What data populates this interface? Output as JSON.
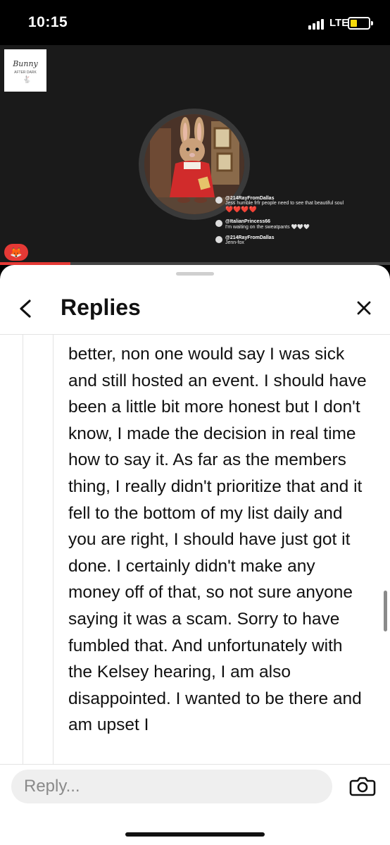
{
  "status_bar": {
    "time": "10:15",
    "network": "LTE"
  },
  "stream": {
    "logo_text": "Bunny",
    "logo_subtext": "AFTER DARK",
    "chat": [
      {
        "user": "@214RayFromDallas",
        "text": "Jess humble frfr people need to see that beautiful soul",
        "hearts": "❤️❤️❤️❤️"
      },
      {
        "user": "@ItalianPrincess66",
        "text": "I'm waiting on the sweatpants 🤍🤍🤍",
        "hearts": ""
      },
      {
        "user": "@214RayFromDallas",
        "text": "Jenn-fox",
        "hearts": ""
      }
    ],
    "progress": 0.18
  },
  "sheet": {
    "title": "Replies",
    "body": "better, non one would say I was sick and still hosted an event. I should have been a little bit more honest but I don't know, I made the decision in real time how to say it.   As far as the members thing, I really didn't prioritize that and it fell to the bottom of my list daily and you are right, I should have just got it done.  I certainly didn't make any money off of that, so not sure anyone saying it was a scam. Sorry to have fumbled that. And unfortunately with the Kelsey hearing,  I am also disappointed.  I wanted to be there and am upset I",
    "reply_placeholder": "Reply..."
  },
  "colors": {
    "accent": "#e53935",
    "battery": "#f5d90a"
  },
  "icons": [
    "back-chevron-icon",
    "close-icon",
    "camera-icon",
    "fox-icon",
    "signal-icon",
    "battery-icon"
  ]
}
